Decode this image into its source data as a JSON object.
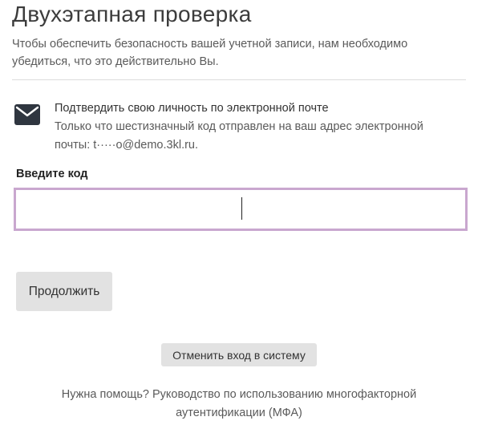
{
  "header": {
    "title": "Двухэтапная проверка",
    "subtitle": "Чтобы обеспечить безопасность вашей учетной записи, нам необходимо убедиться, что это действительно Вы."
  },
  "method": {
    "icon": "envelope-icon",
    "title": "Подтвердить свою личность по электронной почте",
    "description": "Только что шестизначный код отправлен на ваш адрес электронной почты: t·····o@demo.3kl.ru."
  },
  "code": {
    "label": "Введите код",
    "value": "",
    "placeholder": ""
  },
  "actions": {
    "continue_label": "Продолжить",
    "cancel_label": "Отменить вход в систему"
  },
  "help": {
    "prefix": "Нужна помощь?",
    "link_text": "Руководство по использованию многофакторной аутентификации (МФА)"
  },
  "colors": {
    "input_border": "#c9a7cf",
    "button_bg": "#e2e2e2"
  }
}
